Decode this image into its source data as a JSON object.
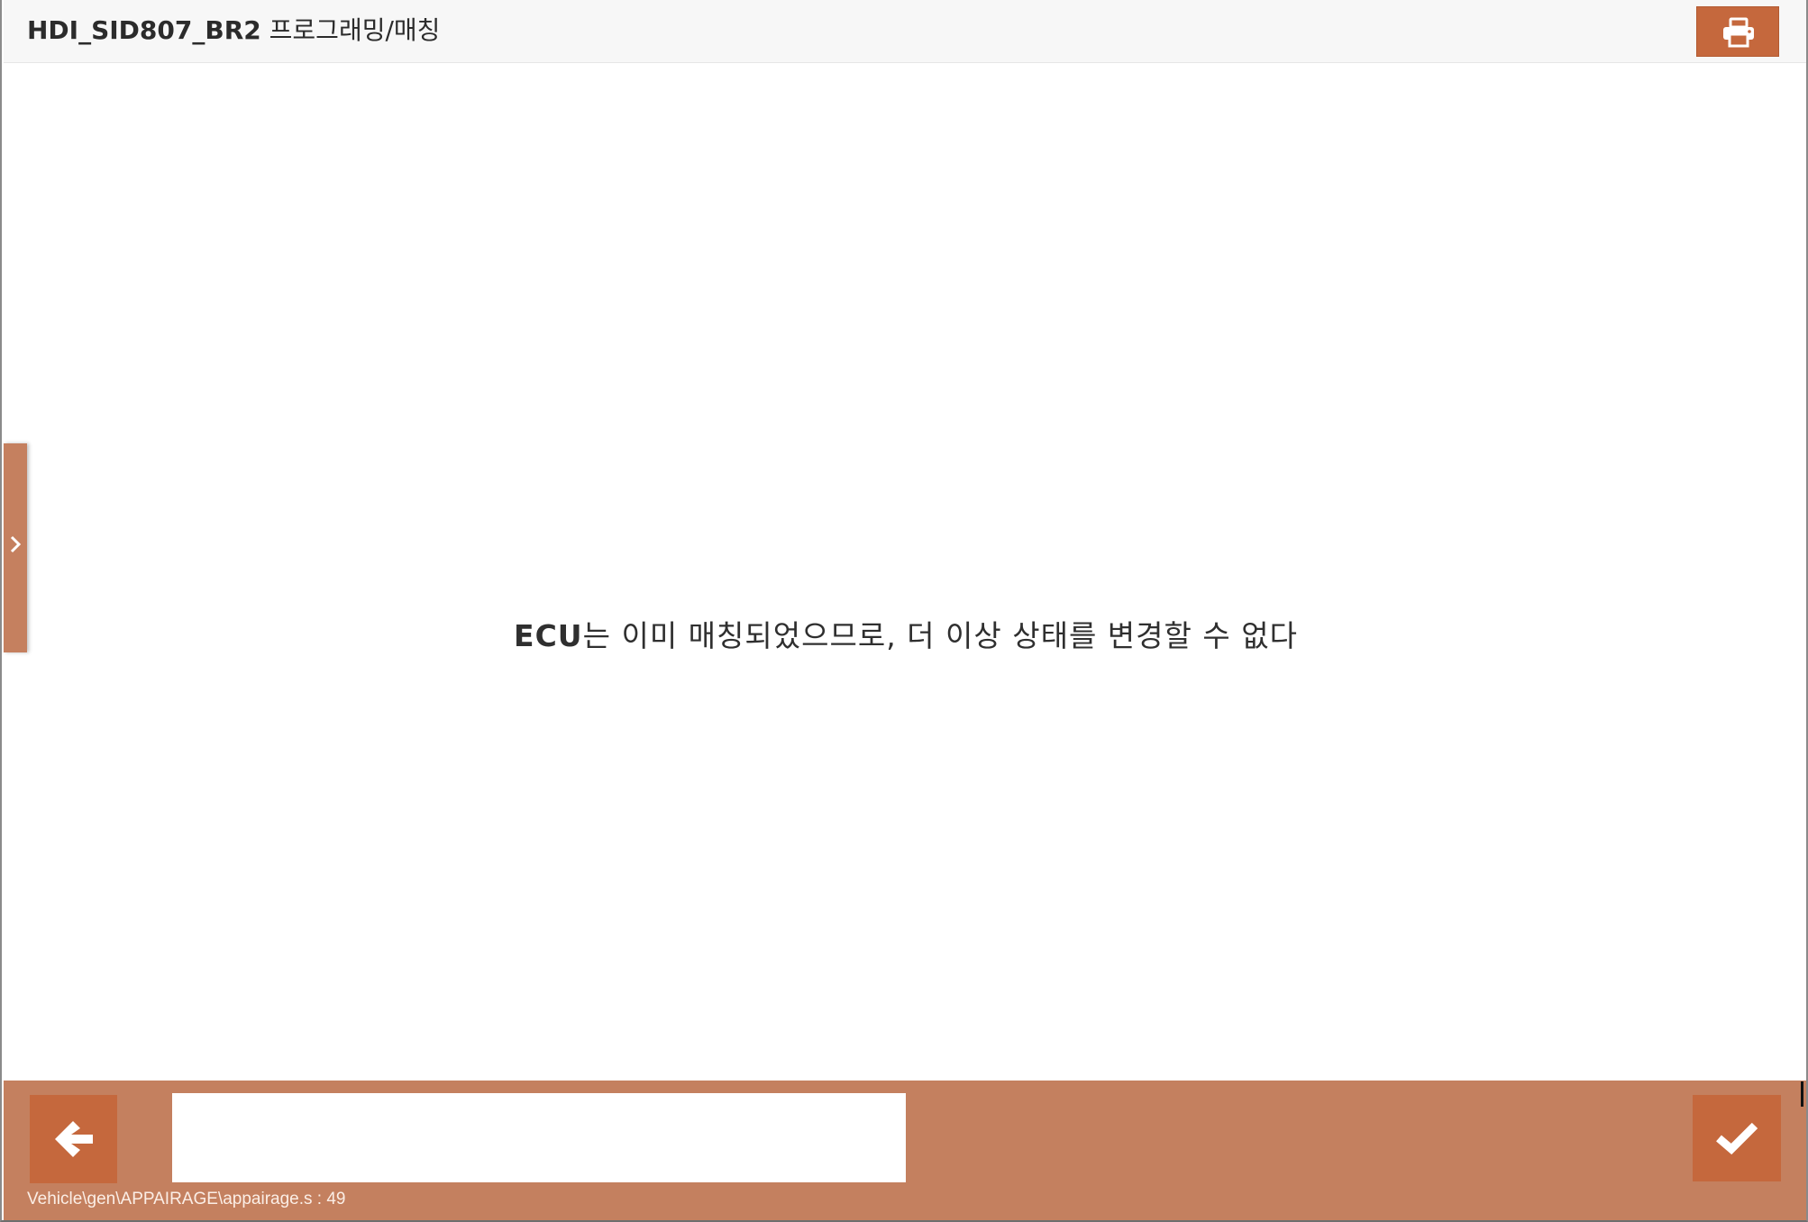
{
  "header": {
    "title_bold": "HDI_SID807_BR2",
    "title_rest": " 프로그래밍/매칭",
    "print_icon": "printer-icon"
  },
  "side_panel": {
    "toggle_icon": "chevron-right-icon"
  },
  "main": {
    "message_bold": "ECU",
    "message_rest": "는 이미 매칭되었으므로, 더 이상 상태를 변경할 수 없다"
  },
  "footer": {
    "back_icon": "arrow-left-icon",
    "input_value": "",
    "confirm_icon": "checkmark-icon",
    "script_path": "Vehicle\\gen\\APPAIRAGE\\appairage.s : 49"
  },
  "colors": {
    "accent": "#c5683d",
    "footer_bg": "#c4805f",
    "header_bg": "#f7f7f7",
    "text": "#2b2b2b"
  }
}
